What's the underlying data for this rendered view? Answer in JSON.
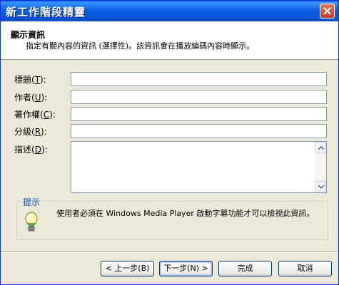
{
  "window": {
    "title": "新工作階段精靈"
  },
  "header": {
    "title": "顯示資訊",
    "subtitle": "指定有關內容的資訊 (選擇性)。該資訊會在播放編碼內容時顯示。"
  },
  "fields": [
    {
      "label": "標題(",
      "key": "T",
      "end": "):",
      "value": ""
    },
    {
      "label": "作者(",
      "key": "U",
      "end": "):",
      "value": ""
    },
    {
      "label": "著作權(",
      "key": "C",
      "end": "):",
      "value": ""
    },
    {
      "label": "分級(",
      "key": "R",
      "end": "):",
      "value": ""
    },
    {
      "label": "描述(",
      "key": "D",
      "end": "):",
      "value": ""
    }
  ],
  "tip": {
    "title": "提示",
    "text": "使用者必須在 Windows Media Player 啟動字幕功能才可以檢視此資訊。"
  },
  "buttons": {
    "back": "< 上一步(B)",
    "next": "下一步(N) >",
    "finish": "完成",
    "cancel": "取消"
  },
  "colors": {
    "titlebar": "#0a55d4",
    "accent": "#0046d5"
  }
}
